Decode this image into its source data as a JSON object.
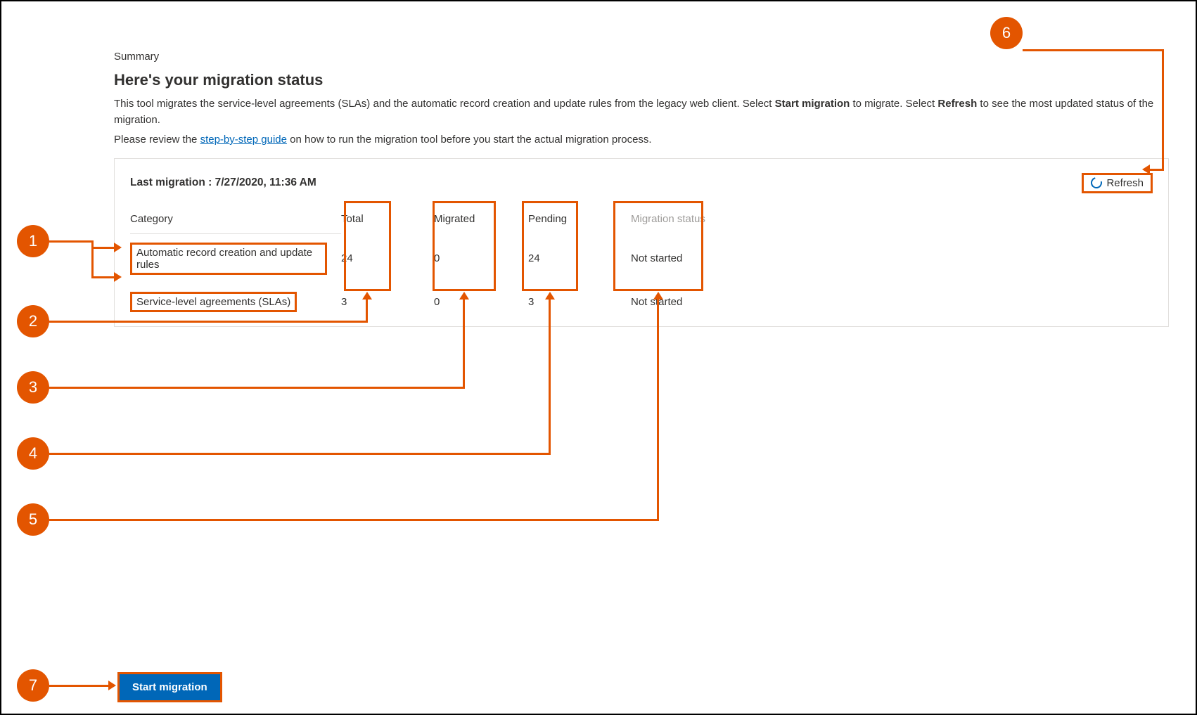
{
  "header": {
    "summary_label": "Summary",
    "title": "Here's your migration status",
    "desc_p1_a": "This tool migrates the service-level agreements (SLAs) and the automatic record creation and update rules from the legacy web client. Select ",
    "desc_p1_b": "Start migration",
    "desc_p1_c": " to migrate. Select ",
    "desc_p1_d": "Refresh",
    "desc_p1_e": " to see the most updated status of the migration.",
    "desc_p2_a": "Please review the ",
    "desc_p2_link": "step-by-step guide",
    "desc_p2_b": " on how to run the migration tool before you start the actual migration process."
  },
  "card": {
    "last_migration_label": "Last migration :",
    "last_migration_value": "7/27/2020, 11:36 AM",
    "refresh_label": "Refresh"
  },
  "table": {
    "columns": {
      "category": "Category",
      "total": "Total",
      "migrated": "Migrated",
      "pending": "Pending",
      "status": "Migration status"
    },
    "rows": [
      {
        "category": "Automatic record creation and update rules",
        "total": "24",
        "migrated": "0",
        "pending": "24",
        "status": "Not started"
      },
      {
        "category": "Service-level agreements (SLAs)",
        "total": "3",
        "migrated": "0",
        "pending": "3",
        "status": "Not started"
      }
    ]
  },
  "buttons": {
    "start_migration": "Start migration"
  },
  "callouts": {
    "c1": "1",
    "c2": "2",
    "c3": "3",
    "c4": "4",
    "c5": "5",
    "c6": "6",
    "c7": "7"
  }
}
